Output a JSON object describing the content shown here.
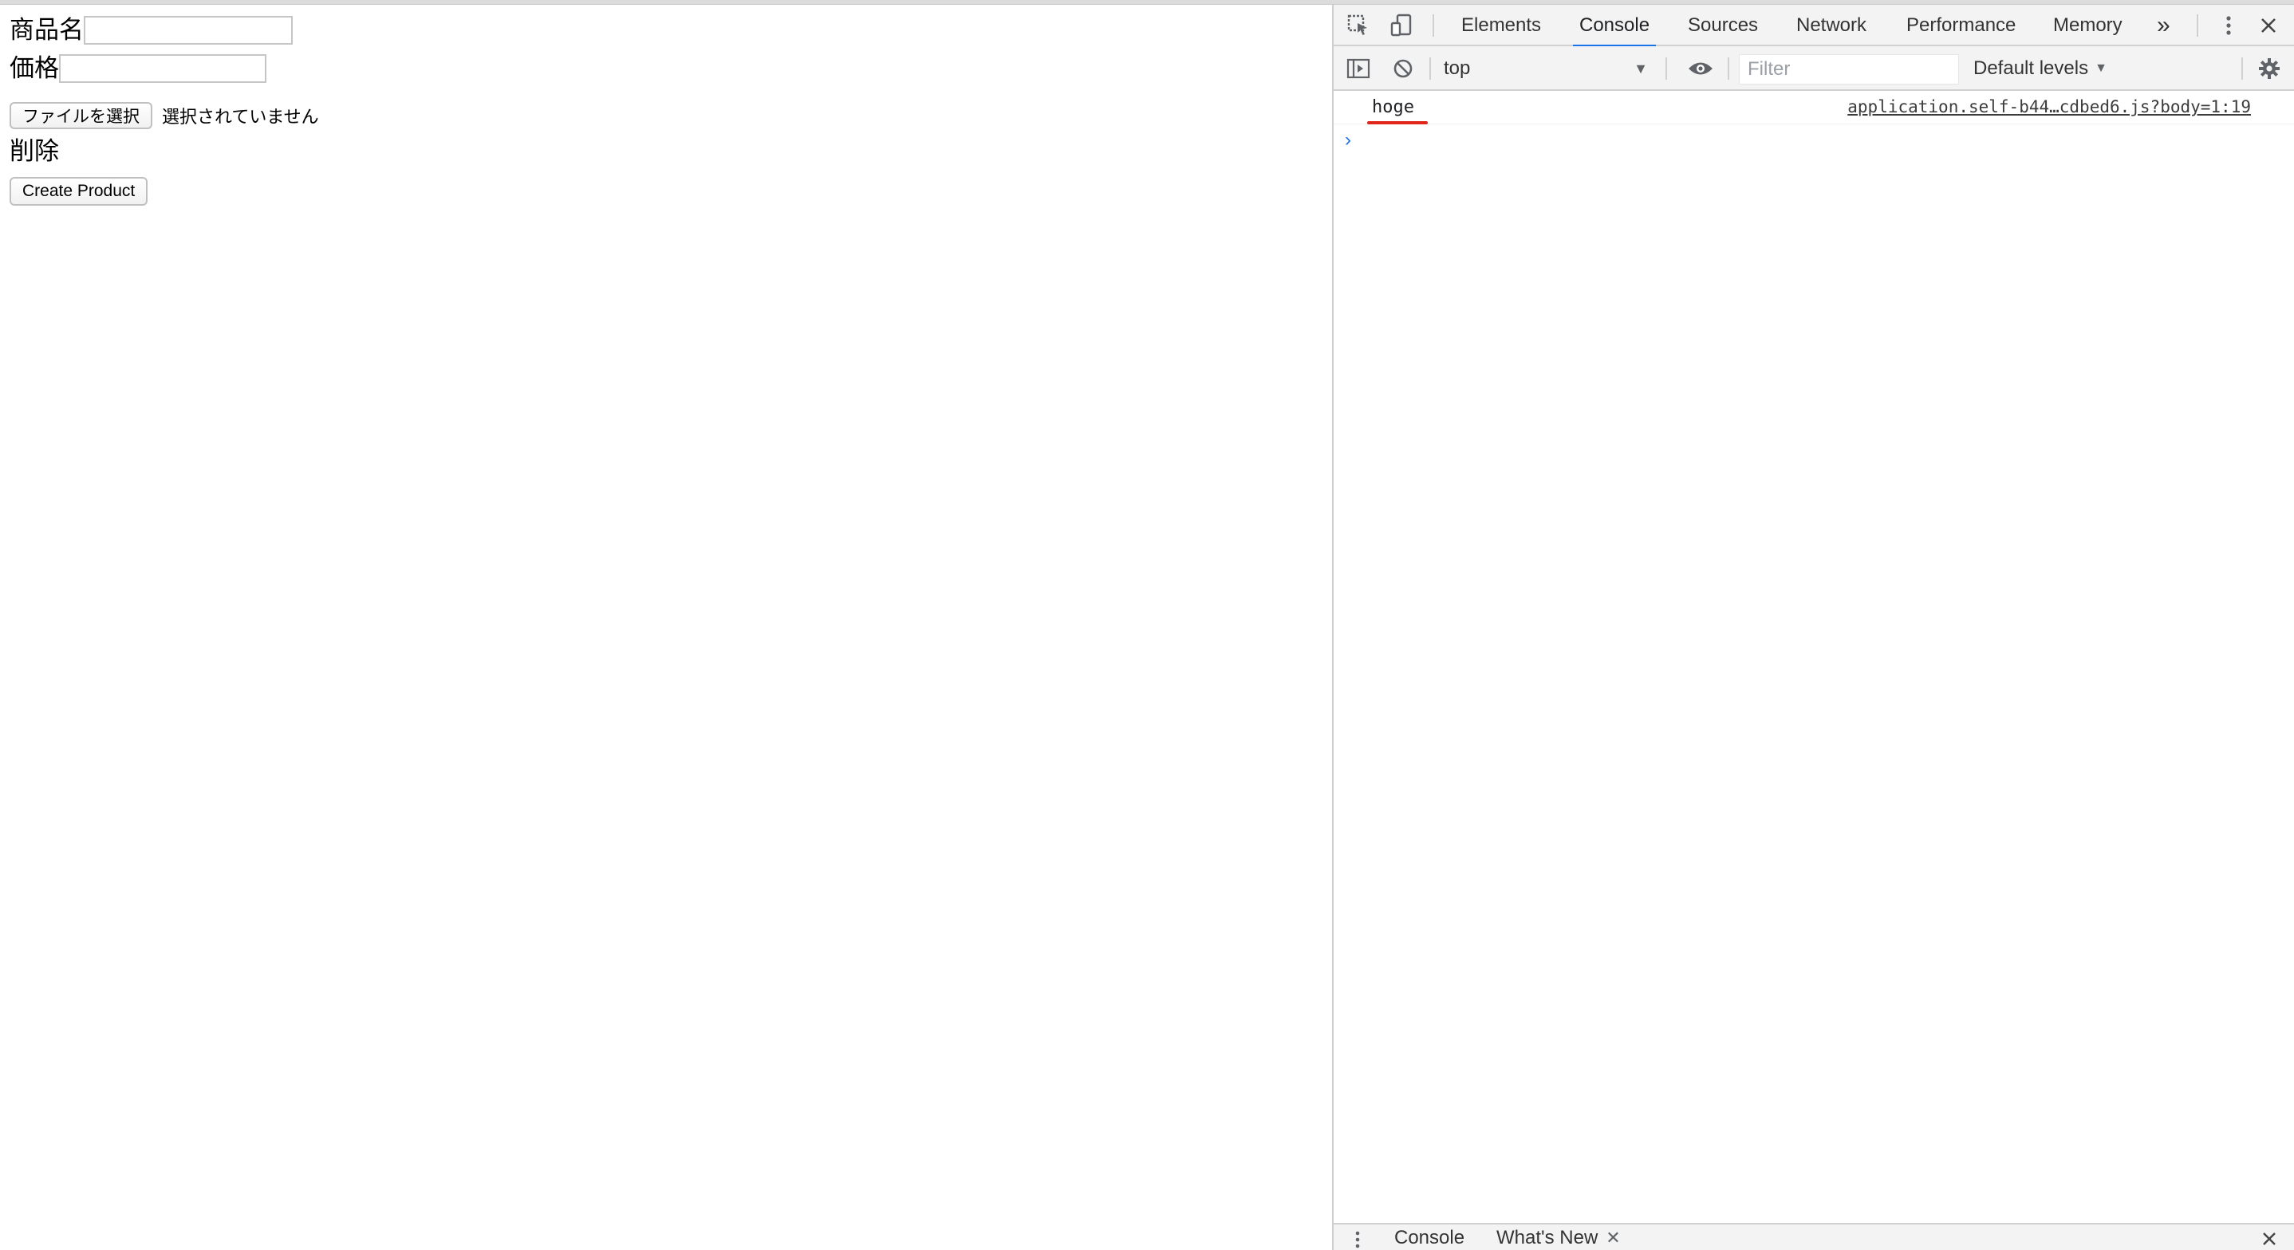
{
  "page": {
    "product_name_label": "商品名",
    "product_name_value": "",
    "price_label": "価格",
    "price_value": "",
    "file_button_label": "ファイルを選択",
    "file_status": "選択されていません",
    "delete_label": "削除",
    "submit_label": "Create Product"
  },
  "devtools": {
    "tabs": [
      "Elements",
      "Console",
      "Sources",
      "Network",
      "Performance",
      "Memory"
    ],
    "active_tab": "Console",
    "more_tabs_glyph": "»",
    "toolbar": {
      "context": "top",
      "filter_placeholder": "Filter",
      "levels": "Default levels"
    },
    "console": {
      "messages": [
        {
          "text": "hoge",
          "source": "application.self-b44…cdbed6.js?body=1:19"
        }
      ],
      "prompt_glyph": "›"
    },
    "drawer": {
      "tabs": [
        "Console",
        "What's New"
      ]
    }
  },
  "colors": {
    "accent": "#1a73e8",
    "highlight_underline": "#e0261b",
    "toolbar_bg": "#f3f3f3"
  }
}
